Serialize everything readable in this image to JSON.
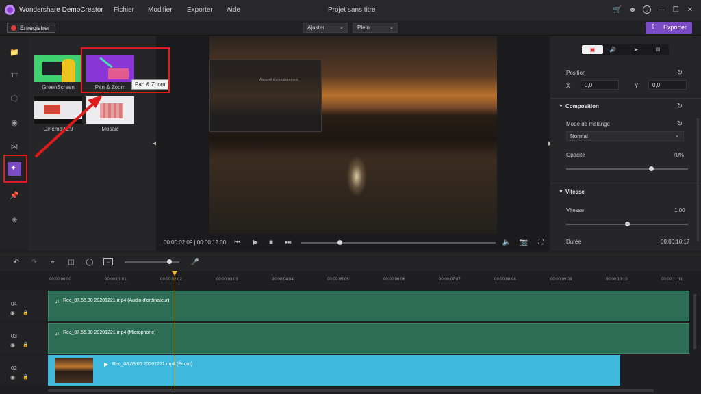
{
  "app": {
    "name": "Wondershare DemoCreator",
    "project_title": "Projet sans titre"
  },
  "menu": [
    "Fichier",
    "Modifier",
    "Exporter",
    "Aide"
  ],
  "toolbar": {
    "record_label": "Enregistrer",
    "fit_value": "Ajuster",
    "quality_value": "Plein",
    "export_label": "Exporter"
  },
  "effects": [
    {
      "label": "GreenScreen"
    },
    {
      "label": "Pan & Zoom"
    },
    {
      "label": "Cinema21:9"
    },
    {
      "label": "Mosaic"
    }
  ],
  "tooltip": "Pan & Zoom",
  "player": {
    "time": "00:00:02:09 | 00:00:12:00",
    "progress": 0.2
  },
  "props": {
    "position_label": "Position",
    "x_label": "X",
    "x_value": "0,0",
    "y_label": "Y",
    "y_value": "0,0",
    "composition_label": "Composition",
    "blend_label": "Mode de mélange",
    "blend_value": "Normal",
    "opacity_label": "Opacité",
    "opacity_value": "70%",
    "speed_section": "Vitesse",
    "speed_label": "Vitesse",
    "speed_value": "1.00",
    "duration_label": "Durée",
    "duration_value": "00:00:10:17",
    "opacity_level": 0.7,
    "speed_level": 0.5
  },
  "timeline": {
    "ticks": [
      "00:00:00:00",
      "00:00:01:01",
      "00:00:02:02",
      "00:00:03:03",
      "00:00:04:04",
      "00:00:05:05",
      "00:00:06:06",
      "00:00:07:07",
      "00:00:08:08",
      "00:00:09:09",
      "00:00:10:10",
      "00:00:11:11"
    ],
    "tracks": [
      {
        "num": "04",
        "clip": "Rec_07.56.30 20201221.mp4 (Audio d'ordinateur)"
      },
      {
        "num": "03",
        "clip": "Rec_07.56.30 20201221.mp4 (Microphone)"
      },
      {
        "num": "02",
        "clip": "Rec_08.09.05 20201221.mp4 (Écran)"
      }
    ],
    "zoom_level": 0.82
  },
  "colors": {
    "accent": "#7a4bc4",
    "record": "#e03a3a",
    "audio_track": "#2e6d55",
    "video_track": "#3eb8dc",
    "playhead": "#f0b429",
    "annotation": "#e01b1b"
  },
  "preview_overlay": {
    "heading": "Appareil d'enregistrement"
  }
}
